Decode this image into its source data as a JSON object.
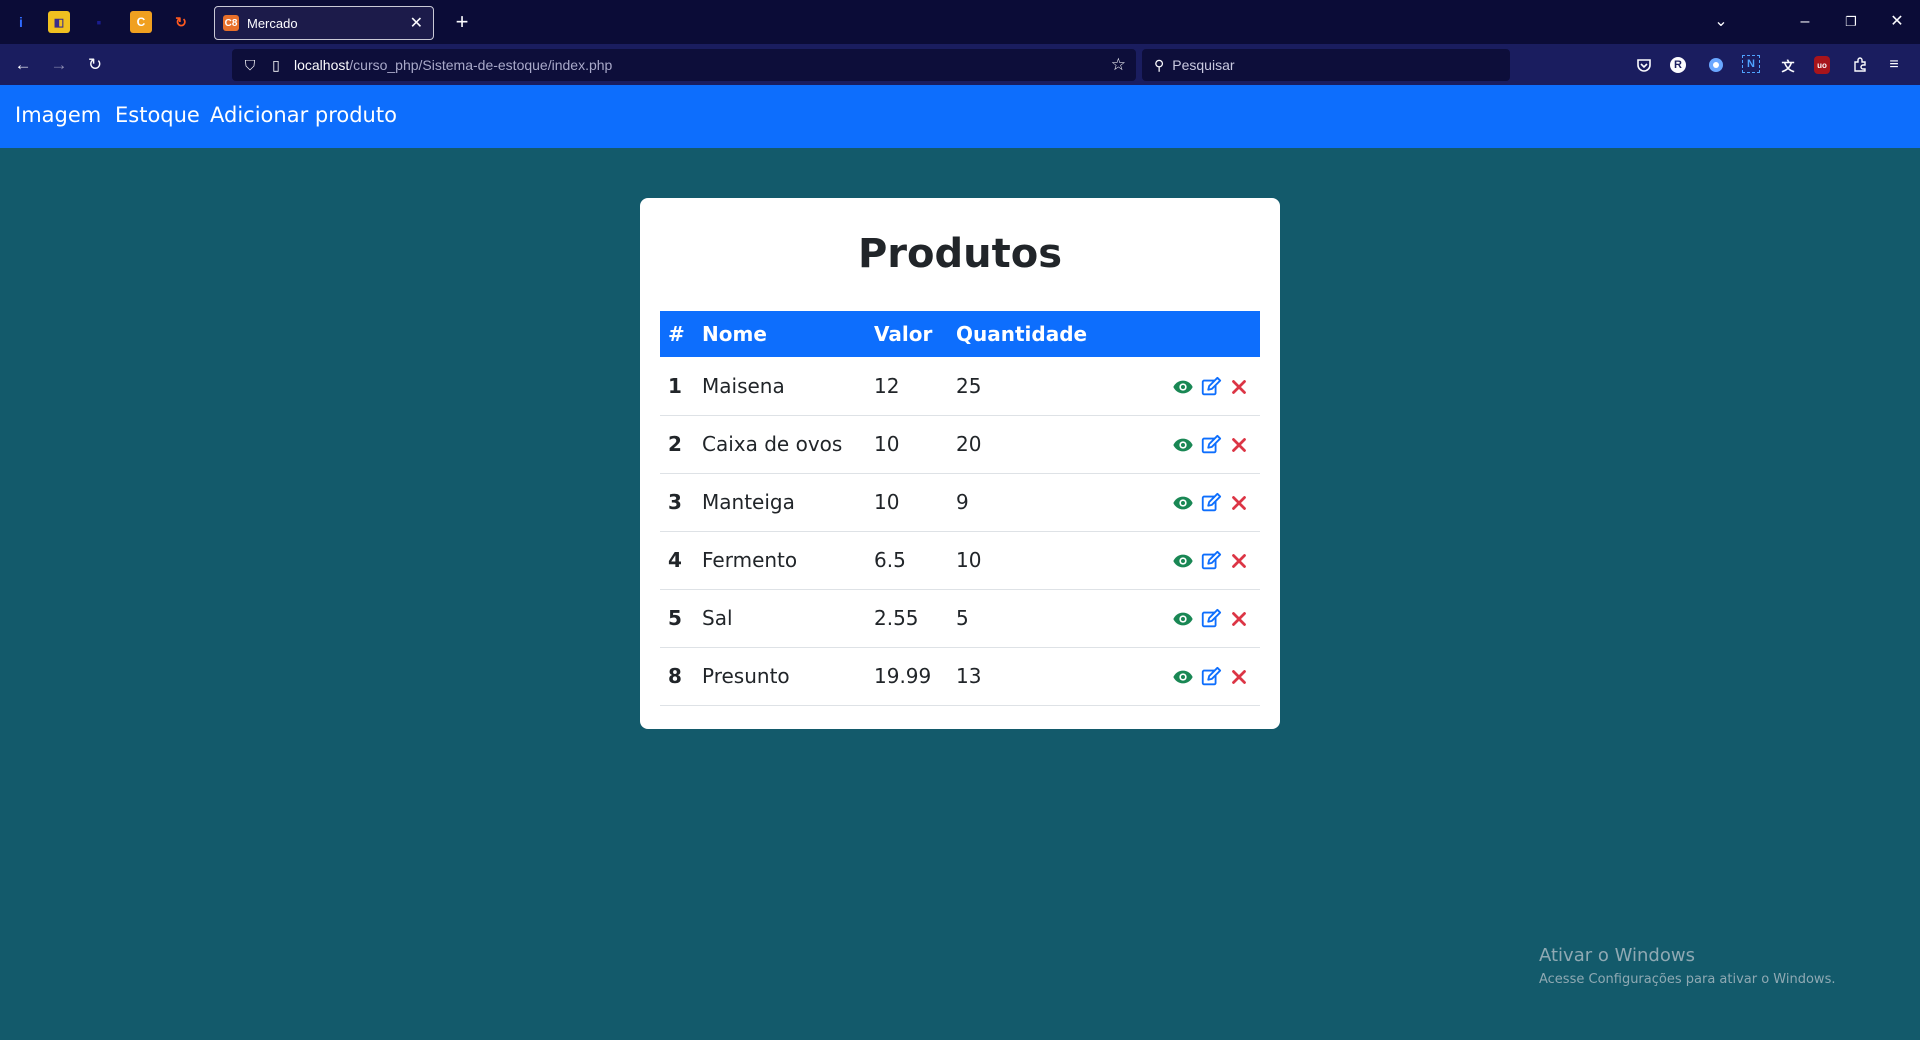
{
  "browser": {
    "tab": {
      "title": "Mercado",
      "favicon": "C8"
    },
    "url": {
      "host": "localhost",
      "path": "/curso_php/Sistema-de-estoque/index.php"
    },
    "search": {
      "placeholder": "Pesquisar"
    },
    "extensions": [
      {
        "name": "pocket-icon"
      },
      {
        "name": "r-extension-icon",
        "glyph": "R"
      },
      {
        "name": "compass-icon"
      },
      {
        "name": "n-extension-icon",
        "glyph": "N"
      },
      {
        "name": "translate-icon",
        "glyph": "文"
      },
      {
        "name": "ublock-icon",
        "glyph": "uo"
      },
      {
        "name": "puzzle-icon"
      },
      {
        "name": "menu-icon"
      }
    ]
  },
  "nav": {
    "links": [
      "Imagem",
      "Estoque",
      "Adicionar produto"
    ]
  },
  "page": {
    "title": "Produtos",
    "table": {
      "headers": [
        "#",
        "Nome",
        "Valor",
        "Quantidade"
      ],
      "rows": [
        {
          "id": "1",
          "nome": "Maisena",
          "valor": "12",
          "quantidade": "25"
        },
        {
          "id": "2",
          "nome": "Caixa de ovos",
          "valor": "10",
          "quantidade": "20"
        },
        {
          "id": "3",
          "nome": "Manteiga",
          "valor": "10",
          "quantidade": "9"
        },
        {
          "id": "4",
          "nome": "Fermento",
          "valor": "6.5",
          "quantidade": "10"
        },
        {
          "id": "5",
          "nome": "Sal",
          "valor": "2.55",
          "quantidade": "5"
        },
        {
          "id": "8",
          "nome": "Presunto",
          "valor": "19.99",
          "quantidade": "13"
        }
      ]
    }
  },
  "watermark": {
    "title": "Ativar o Windows",
    "subtitle": "Acesse Configurações para ativar o Windows."
  },
  "colors": {
    "primary": "#0d6efd",
    "background": "#135a6b",
    "view": "#198754",
    "edit": "#0d6efd",
    "delete": "#dc3545"
  }
}
